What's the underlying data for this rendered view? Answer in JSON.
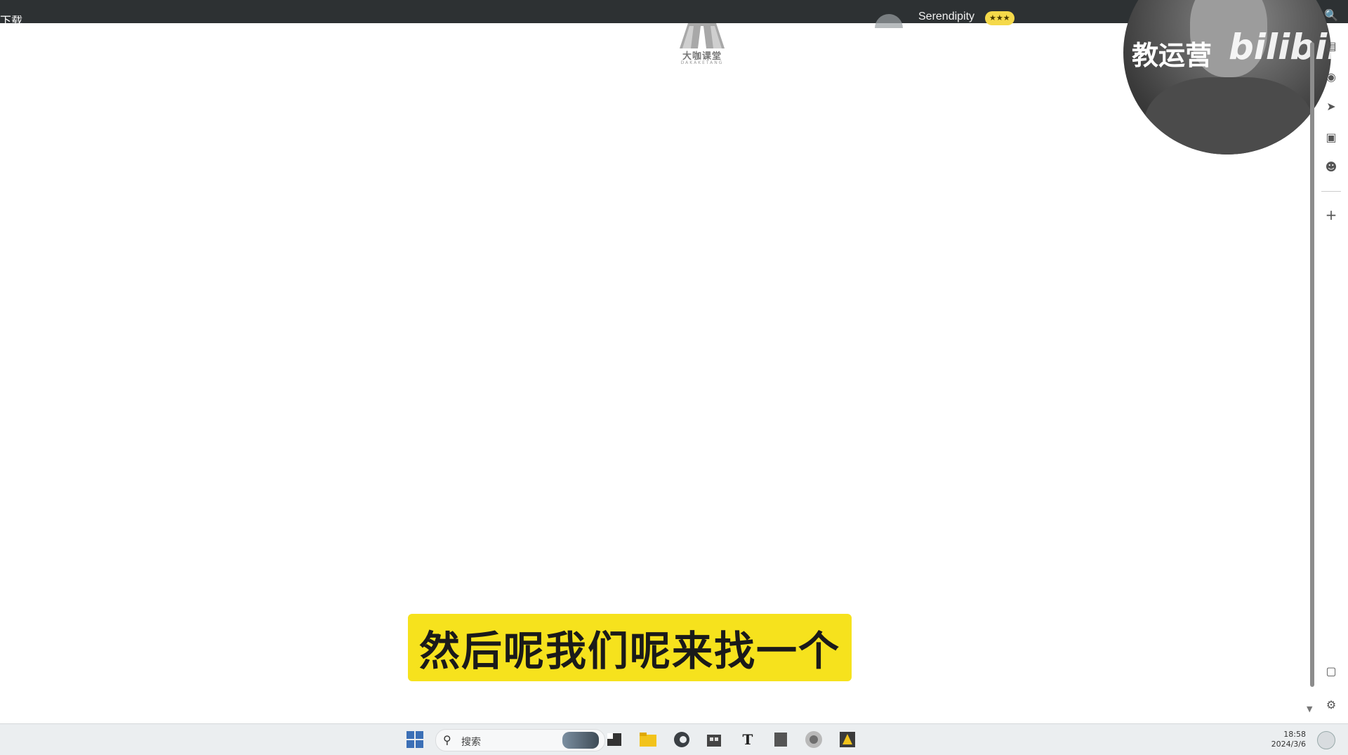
{
  "topbar": {
    "left_text": "下载",
    "username": "Serendipity",
    "badge": "★★★"
  },
  "logo": {
    "text": "大咖课堂",
    "subtext": "DAKAKETANG"
  },
  "webcam": {
    "overlay_text": "教运营",
    "brand": "bilibili"
  },
  "subtitle": {
    "text": "然后呢我们呢来找一个"
  },
  "right_sidebar": {
    "icons": [
      "search-icon",
      "briefcase-icon",
      "puzzle-icon",
      "paper-plane-icon",
      "game-icon",
      "robot-icon",
      "plus-icon",
      "screenshot-icon",
      "gear-icon"
    ]
  },
  "taskbar": {
    "search_placeholder": "搜索",
    "time": "18:58",
    "date": "2024/3/6",
    "apps": [
      "task-view-icon",
      "file-explorer-icon",
      "edge-icon",
      "store-icon",
      "text-icon",
      "notes-icon",
      "app-icon",
      "app2-icon"
    ]
  }
}
